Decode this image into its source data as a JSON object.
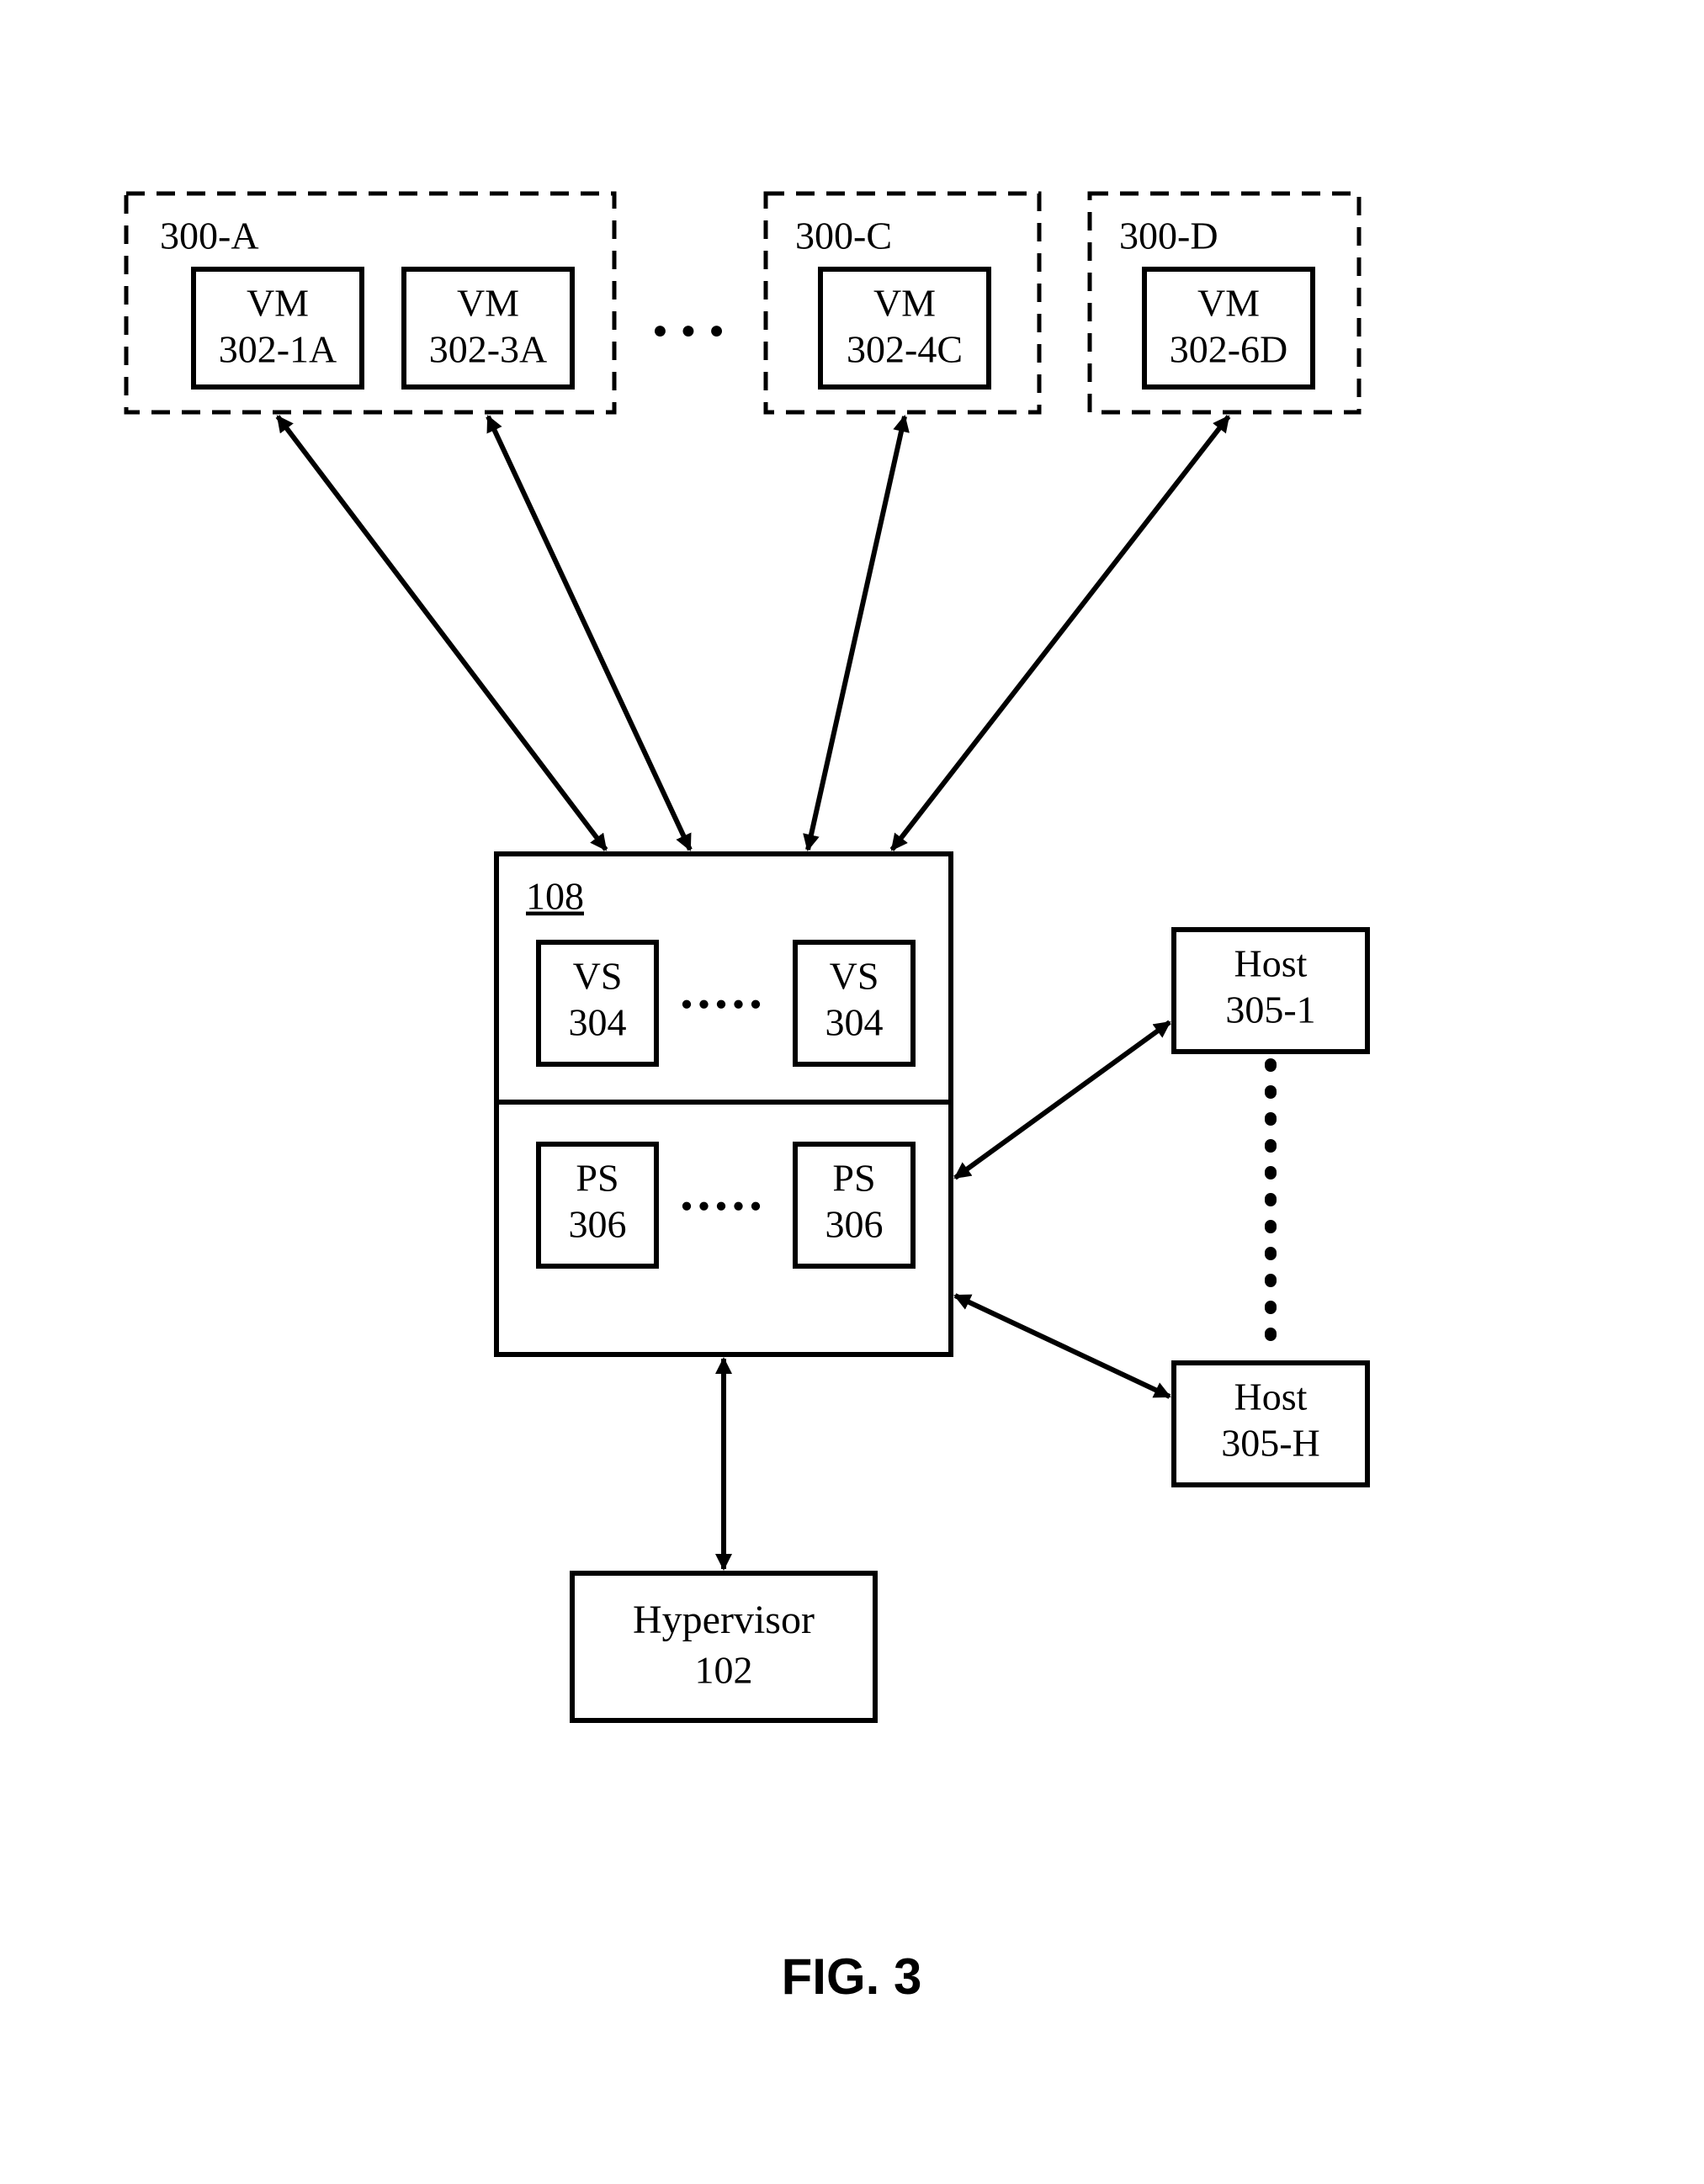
{
  "groups": {
    "a": {
      "label": "300-A",
      "vm1": {
        "l1": "VM",
        "l2": "302-1A"
      },
      "vm2": {
        "l1": "VM",
        "l2": "302-3A"
      }
    },
    "c": {
      "label": "300-C",
      "vm": {
        "l1": "VM",
        "l2": "302-4C"
      }
    },
    "d": {
      "label": "300-D",
      "vm": {
        "l1": "VM",
        "l2": "302-6D"
      }
    }
  },
  "ellipsis_top": "● ● ●",
  "center": {
    "id": "108",
    "vs1": {
      "l1": "VS",
      "l2": "304"
    },
    "vs2": {
      "l1": "VS",
      "l2": "304"
    },
    "ps1": {
      "l1": "PS",
      "l2": "306"
    },
    "ps2": {
      "l1": "PS",
      "l2": "306"
    },
    "dots": "●●●●●"
  },
  "hosts": {
    "h1": {
      "l1": "Host",
      "l2": "305-1"
    },
    "h2": {
      "l1": "Host",
      "l2": "305-H"
    }
  },
  "hypervisor": {
    "l1": "Hypervisor",
    "l2": "102"
  },
  "caption": "FIG. 3"
}
